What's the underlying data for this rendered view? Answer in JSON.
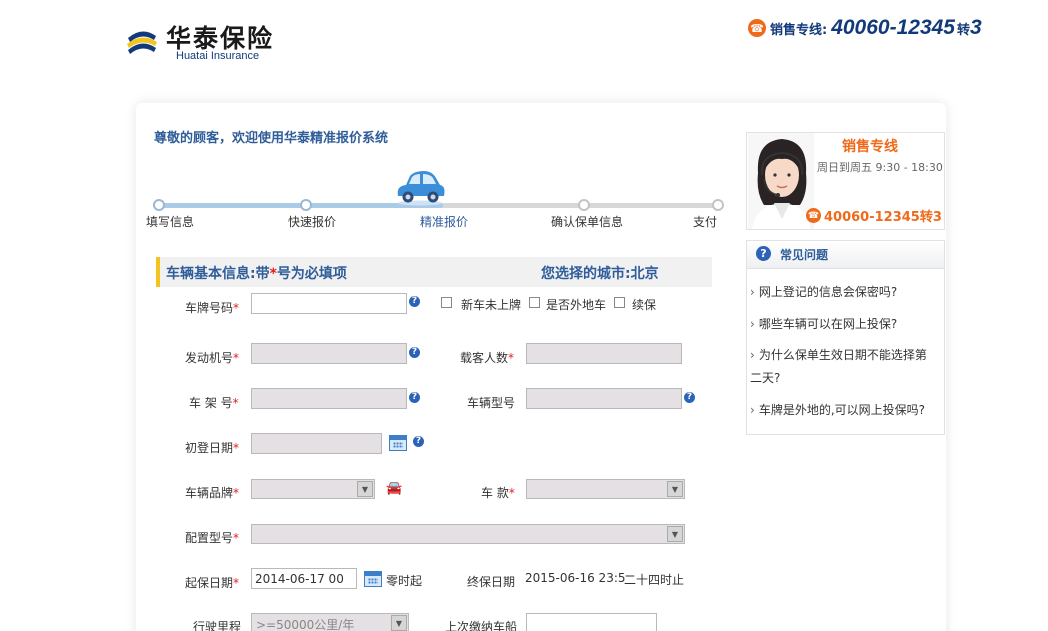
{
  "header": {
    "logo_cn": "华泰保险",
    "logo_en": "Huatai Insurance",
    "hotline_label": "销售专线:",
    "hotline_number": "40060-12345",
    "hotline_ext_label": "转",
    "hotline_ext": "3"
  },
  "welcome": "尊敬的顾客，欢迎使用华泰精准报价系统",
  "steps": [
    {
      "label": "填写信息"
    },
    {
      "label": "快速报价"
    },
    {
      "label": "精准报价"
    },
    {
      "label": "确认保单信息"
    },
    {
      "label": "支付"
    }
  ],
  "section": {
    "title_prefix": "车辆基本信息:带",
    "title_star": "*",
    "title_suffix": "号为必填项",
    "city": "您选择的城市:北京"
  },
  "form": {
    "plate": {
      "label": "车牌号码",
      "value": ""
    },
    "new_car": "新车未上牌",
    "out_of_town": "是否外地车",
    "renewal": "续保",
    "engine": {
      "label": "发动机号",
      "value": ""
    },
    "passengers": {
      "label": "载客人数",
      "value": ""
    },
    "frame": {
      "label": "车 架 号",
      "value": ""
    },
    "model_no": {
      "label": "车辆型号",
      "value": ""
    },
    "first_reg": {
      "label": "初登日期",
      "value": ""
    },
    "brand": {
      "label": "车辆品牌"
    },
    "style": {
      "label": "车 款"
    },
    "config": {
      "label": "配置型号"
    },
    "start_date": {
      "label": "起保日期",
      "value": "2014-06-17 00",
      "suffix": "零时起"
    },
    "end_date": {
      "label": "终保日期",
      "value": "2015-06-16 23:5",
      "suffix": "二十四时止"
    },
    "mileage": {
      "label": "行驶里程",
      "value": ">=50000公里/年"
    },
    "last_tax": {
      "label": "上次缴纳车船",
      "value": ""
    }
  },
  "required_star": "*",
  "sales": {
    "title": "销售专线",
    "hours": "周日到周五 9:30 - 18:30",
    "phone": "40060-12345转3"
  },
  "faq": {
    "title": "常见问题",
    "items": [
      "网上登记的信息会保密吗?",
      "哪些车辆可以在网上投保?",
      "为什么保单生效日期不能选择第二天?",
      "车牌是外地的,可以网上投保吗?"
    ]
  },
  "icons": {
    "help": "help-icon",
    "calendar": "calendar-icon",
    "car": "car-icon",
    "phone": "phone-icon"
  },
  "colors": {
    "brand_blue": "#2f5d9a",
    "accent_orange": "#ef6a1a",
    "required_red": "#e02020",
    "section_bar": "#f4c41e"
  }
}
